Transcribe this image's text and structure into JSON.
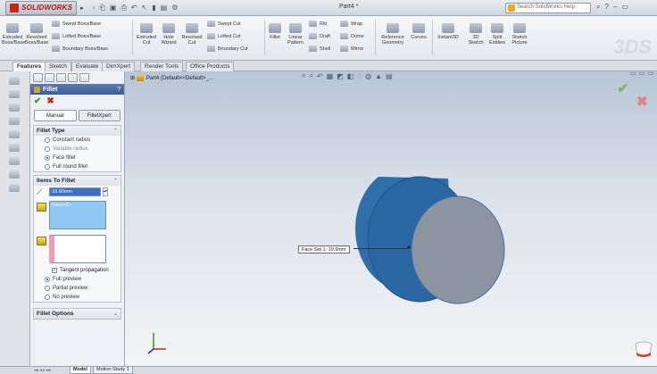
{
  "app": {
    "logo": "SOLIDWORKS",
    "document_title": "Part4 *",
    "search_placeholder": "Search SolidWorks Help"
  },
  "command_manager": {
    "big_buttons": [
      {
        "id": "extruded-boss",
        "label": "Extruded\nBoss/Base"
      },
      {
        "id": "revolved-boss",
        "label": "Revolved\nBoss/Base"
      },
      {
        "id": "extruded-cut",
        "label": "Extruded\nCut"
      },
      {
        "id": "hole-wizard",
        "label": "Hole\nWizard"
      },
      {
        "id": "revolved-cut",
        "label": "Revolved\nCut"
      },
      {
        "id": "fillet",
        "label": "Fillet"
      },
      {
        "id": "linear-pattern",
        "label": "Linear\nPattern"
      },
      {
        "id": "reference-geometry",
        "label": "Reference\nGeometry"
      },
      {
        "id": "curves",
        "label": "Curves"
      },
      {
        "id": "instant3d",
        "label": "Instant3D"
      },
      {
        "id": "3d-sketch",
        "label": "3D\nSketch"
      },
      {
        "id": "split-entities",
        "label": "Split\nEntities"
      },
      {
        "id": "sketch-picture",
        "label": "Sketch\nPicture"
      }
    ],
    "small_buttons": {
      "swept_boss": "Swept Boss/Base",
      "lofted_boss": "Lofted Boss/Base",
      "boundary_boss": "Boundary Boss/Base",
      "swept_cut": "Swept Cut",
      "lofted_cut": "Lofted Cut",
      "boundary_cut": "Boundary Cut",
      "rib": "Rib",
      "draft": "Draft",
      "shell": "Shell",
      "wrap": "Wrap",
      "dome": "Dome",
      "mirror": "Mirror"
    }
  },
  "tabs": [
    "Features",
    "Sketch",
    "Evaluate",
    "DimXpert",
    "Render Tools",
    "Office Products"
  ],
  "active_tab": "Features",
  "tree_root": "Part4  (Default<<Default>_...",
  "property_manager": {
    "title": "Fillet",
    "help": "?",
    "mode_tabs": [
      "Manual",
      "FilletXpert"
    ],
    "fillet_type": {
      "heading": "Fillet Type",
      "options": [
        "Constant radius",
        "Variable radius",
        "Face fillet",
        "Full round fillet"
      ],
      "selected": "Face fillet"
    },
    "items_to_fillet": {
      "heading": "Items To Fillet",
      "radius": "19.90mm",
      "face_set_1": "Face<2>",
      "face_set_2": ""
    },
    "tangent_propagation": "Tangent propagation",
    "preview_options": [
      "Full preview",
      "Partial preview",
      "No preview"
    ],
    "preview_selected": "Full preview",
    "fillet_options_heading": "Fillet Options"
  },
  "viewport": {
    "callout": "Face Set 1: 19.9mm",
    "shape_colors": {
      "side": "#2e6fa9",
      "face": "#8c94a0",
      "outline": "#1f4f88"
    }
  },
  "bottom_tabs": [
    "Model",
    "Motion Study 1"
  ],
  "active_bottom_tab": "Model"
}
